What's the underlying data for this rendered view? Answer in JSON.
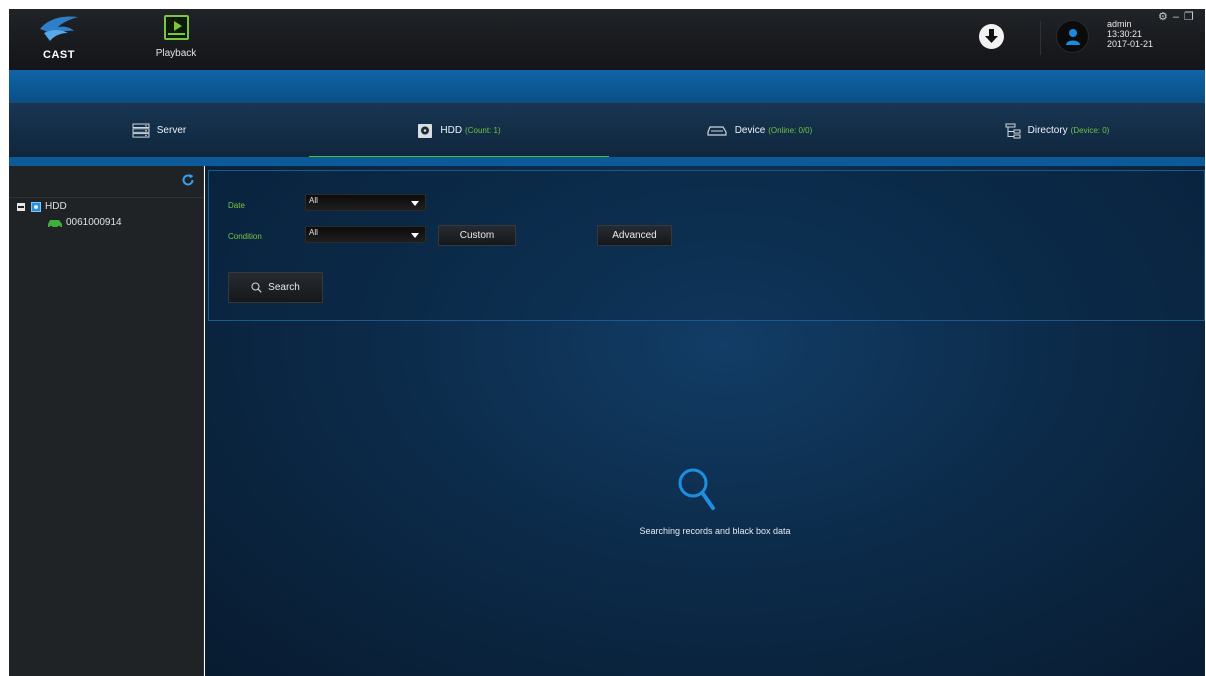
{
  "header": {
    "logo_text": "CAST",
    "module": {
      "label": "Playback",
      "icon": "playback-monitor-icon"
    },
    "user": {
      "name": "admin",
      "time": "13:30:21",
      "date": "2017-01-21"
    },
    "window_controls": [
      "gear-icon",
      "minimize-icon",
      "restore-icon"
    ]
  },
  "tabs": [
    {
      "label": "Server",
      "count": "",
      "icon": "server-icon"
    },
    {
      "label": "HDD",
      "count": "(Count: 1)",
      "icon": "hdd-icon",
      "active": true
    },
    {
      "label": "Device",
      "count": "(Online: 0/0)",
      "icon": "vehicle-icon"
    },
    {
      "label": "Directory",
      "count": "(Device: 0)",
      "icon": "directory-tree-icon"
    }
  ],
  "tree": {
    "root": {
      "label": "HDD",
      "expanded": true
    },
    "children": [
      {
        "label": "0061000914",
        "icon": "vehicle-icon"
      }
    ]
  },
  "search": {
    "date_label": "Date",
    "date_value": "All",
    "condition_label": "Condition",
    "condition_value": "All",
    "custom_label": "Custom",
    "advanced_label": "Advanced",
    "search_label": "Search"
  },
  "empty_state": {
    "message": "Searching records and black box data"
  },
  "colors": {
    "accent_green": "#4cc12f",
    "brand_blue": "#0f64a8",
    "label_green": "#7ac63f"
  }
}
